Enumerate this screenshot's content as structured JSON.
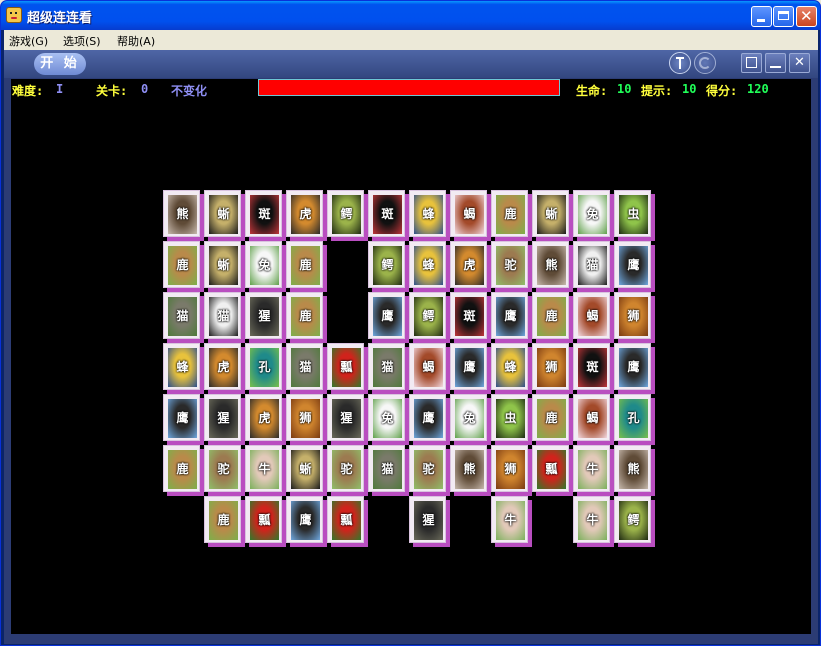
{
  "window": {
    "title": "超级连连看"
  },
  "menu": [
    "游戏(G)",
    "选项(S)",
    "帮助(A)"
  ],
  "toolbar": {
    "start_label": "开 始"
  },
  "status": {
    "difficulty_label": "难度:",
    "difficulty_value": "I",
    "level_label": "关卡:",
    "level_value": "0",
    "mode": "不变化",
    "time_progress": 1.0,
    "lives_label": "生命:",
    "lives_value": "10",
    "hints_label": "提示:",
    "hints_value": "10",
    "score_label": "得分:",
    "score_value": "120"
  },
  "animals": {
    "bear": {
      "c1": "#5f4b37",
      "c2": "#c7b9ad",
      "glyph": "熊"
    },
    "chameleon": {
      "c1": "#c5b06a",
      "c2": "#1a1a1a",
      "glyph": "蜥"
    },
    "zebra": {
      "c1": "#111111",
      "c2": "#c0363a",
      "glyph": "斑"
    },
    "tiger": {
      "c1": "#d38a2e",
      "c2": "#2a2a2a",
      "glyph": "虎"
    },
    "crocodile": {
      "c1": "#9bb34a",
      "c2": "#1f2a12",
      "glyph": "鳄"
    },
    "wasp": {
      "c1": "#e8c23c",
      "c2": "#2e4f8c",
      "glyph": "蜂"
    },
    "scorpion": {
      "c1": "#a34a2a",
      "c2": "#f2d8e0",
      "glyph": "蝎"
    },
    "deer": {
      "c1": "#b98a4a",
      "c2": "#7cb04a",
      "glyph": "鹿"
    },
    "rabbit": {
      "c1": "#f7f7f7",
      "c2": "#5fa04a",
      "glyph": "兔"
    },
    "grasshopper": {
      "c1": "#8fc44a",
      "c2": "#1c2a12",
      "glyph": "虫"
    },
    "panda": {
      "c1": "#f0f0f0",
      "c2": "#1c1c1c",
      "glyph": "猫"
    },
    "eagle": {
      "c1": "#2a2a2a",
      "c2": "#6fa8e0",
      "glyph": "鹰"
    },
    "camel": {
      "c1": "#9c7a50",
      "c2": "#8fc06a",
      "glyph": "驼"
    },
    "cat": {
      "c1": "#7a7a6a",
      "c2": "#4e7a3a",
      "glyph": "猫"
    },
    "gorilla": {
      "c1": "#2a2a2a",
      "c2": "#6a6a5a",
      "glyph": "猩"
    },
    "lion": {
      "c1": "#d0852e",
      "c2": "#7a3a12",
      "glyph": "狮"
    },
    "peacock": {
      "c1": "#1f8a8a",
      "c2": "#7ac04a",
      "glyph": "孔"
    },
    "ladybug": {
      "c1": "#d0231c",
      "c2": "#2f7a2a",
      "glyph": "瓢"
    },
    "cow": {
      "c1": "#e2c9b9",
      "c2": "#7ab05a",
      "glyph": "牛"
    }
  },
  "board": {
    "columns": 12,
    "rows": [
      [
        "bear",
        "chameleon",
        "zebra",
        "tiger",
        "crocodile",
        "zebra",
        "wasp",
        "scorpion",
        "deer",
        "chameleon",
        "rabbit",
        "grasshopper"
      ],
      [
        "deer",
        "chameleon",
        "rabbit",
        "deer",
        null,
        "crocodile",
        "wasp",
        "tiger",
        "camel",
        "bear",
        "panda",
        "eagle"
      ],
      [
        "cat",
        "panda",
        "gorilla",
        "deer",
        null,
        "eagle",
        "crocodile",
        "zebra",
        "eagle",
        "deer",
        "scorpion",
        "lion"
      ],
      [
        "wasp",
        "tiger",
        "peacock",
        "cat",
        "ladybug",
        "cat",
        "scorpion",
        "eagle",
        "wasp",
        "lion",
        "zebra",
        "eagle"
      ],
      [
        "eagle",
        "gorilla",
        "tiger",
        "lion",
        "gorilla",
        "rabbit",
        "eagle",
        "rabbit",
        "grasshopper",
        "deer",
        "scorpion",
        "peacock"
      ],
      [
        "deer",
        "camel",
        "cow",
        "chameleon",
        "camel",
        "cat",
        "camel",
        "bear",
        "lion",
        "ladybug",
        "cow",
        "bear"
      ],
      [
        null,
        "deer",
        "ladybug",
        "eagle",
        "ladybug",
        null,
        "gorilla",
        null,
        "cow",
        null,
        "cow",
        "crocodile"
      ]
    ]
  }
}
